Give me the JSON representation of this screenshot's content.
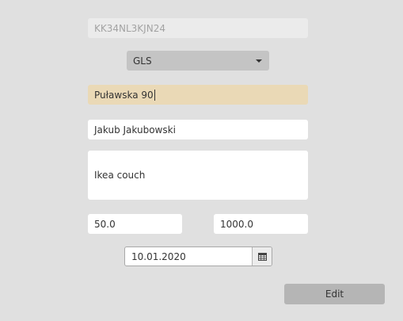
{
  "form": {
    "tracking_number": "KK34NL3KJN24",
    "carrier": {
      "selected": "GLS"
    },
    "address": "Puławska 90",
    "recipient": "Jakub Jakubowski",
    "description": "Ikea couch",
    "weight": "50.0",
    "value": "1000.0",
    "date": "10.01.2020",
    "calendar_icon": "calendar-icon",
    "dropdown_icon": "chevron-down-icon"
  },
  "actions": {
    "edit_label": "Edit"
  },
  "colors": {
    "background": "#e0e0e0",
    "focused_field": "#ead9b6",
    "disabled_field": "#ebebeb",
    "combo_box": "#c4c4c4",
    "button": "#b5b5b5"
  }
}
